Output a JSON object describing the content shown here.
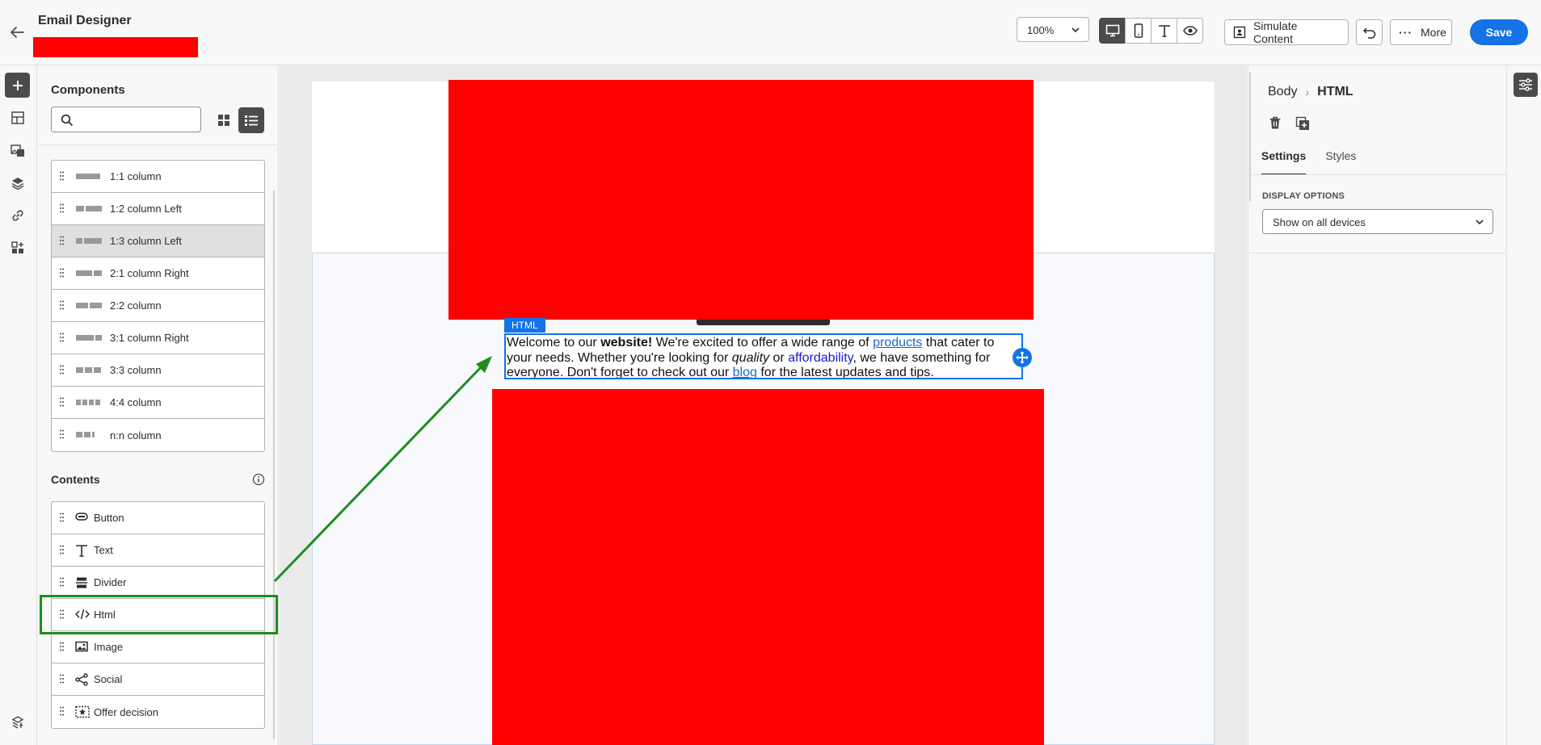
{
  "header": {
    "title": "Email Designer",
    "zoom": "100%",
    "simulate_label": "Simulate Content",
    "more_label": "More",
    "save_label": "Save",
    "accent": "#1473e6"
  },
  "components": {
    "title": "Components",
    "search_placeholder": "",
    "structures": [
      {
        "label": "1:1 column",
        "bars": [
          30
        ]
      },
      {
        "label": "1:2 column Left",
        "bars": [
          10,
          20
        ]
      },
      {
        "label": "1:3 column Left",
        "bars": [
          8,
          22
        ],
        "highlighted": true
      },
      {
        "label": "2:1 column Right",
        "bars": [
          20,
          10
        ]
      },
      {
        "label": "2:2 column",
        "bars": [
          15,
          15
        ]
      },
      {
        "label": "3:1 column Right",
        "bars": [
          22,
          8
        ]
      },
      {
        "label": "3:3 column",
        "bars": [
          9,
          9,
          9
        ]
      },
      {
        "label": "4:4 column",
        "bars": [
          6,
          6,
          6,
          6
        ]
      },
      {
        "label": "n:n column",
        "bars": [
          8,
          8,
          3
        ]
      }
    ]
  },
  "contents": {
    "title": "Contents",
    "items": [
      {
        "label": "Button",
        "icon": "button-icon"
      },
      {
        "label": "Text",
        "icon": "text-icon"
      },
      {
        "label": "Divider",
        "icon": "divider-icon"
      },
      {
        "label": "Html",
        "icon": "code-icon"
      },
      {
        "label": "Image",
        "icon": "image-icon"
      },
      {
        "label": "Social",
        "icon": "share-icon"
      },
      {
        "label": "Offer decision",
        "icon": "offer-icon"
      }
    ]
  },
  "canvas": {
    "html_tag": "HTML",
    "html_content": {
      "p1": "Welcome to our ",
      "b1": "website!",
      "p2": " We're excited to offer a wide range of ",
      "link1": "products",
      "p3": " that cater to your needs. Whether you're looking for ",
      "i1": "quality",
      "p4": " or ",
      "link2": "affordability",
      "p5": ", we have something for everyone. Don't forget to check out our ",
      "link3": "blog",
      "p6": " for the latest updates and tips."
    }
  },
  "properties": {
    "breadcrumb_parent": "Body",
    "breadcrumb_current": "HTML",
    "tabs": [
      "Settings",
      "Styles"
    ],
    "display_options_label": "DISPLAY OPTIONS",
    "display_options_value": "Show on all devices"
  }
}
